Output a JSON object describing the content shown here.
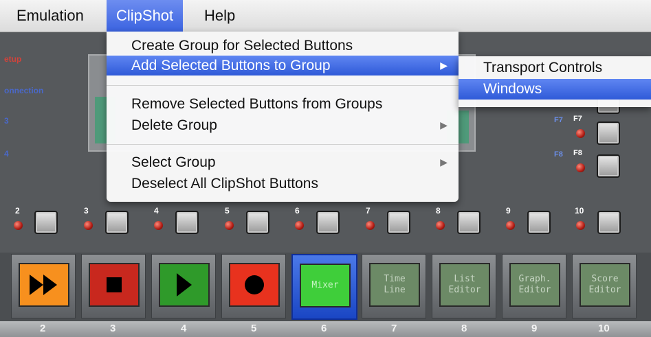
{
  "menubar": {
    "items": [
      {
        "label": "Emulation"
      },
      {
        "label": "ClipShot"
      },
      {
        "label": "Help"
      }
    ]
  },
  "clipshot_menu": {
    "items": [
      {
        "label": "Create Group for Selected Buttons"
      },
      {
        "label": "Add Selected Buttons to Group",
        "arrow": "▶"
      },
      {
        "label": "Remove Selected Buttons from Groups"
      },
      {
        "label": "Delete Group",
        "arrow": "▶"
      },
      {
        "label": "Select Group",
        "arrow": "▶"
      },
      {
        "label": "Deselect All ClipShot Buttons"
      }
    ]
  },
  "group_submenu": {
    "items": [
      {
        "label": "Transport Controls"
      },
      {
        "label": "Windows"
      }
    ]
  },
  "side_labels": [
    "etup",
    "onnection",
    "3",
    "4"
  ],
  "fkeys": {
    "f7_blue": "F7",
    "f7_white": "F7",
    "f8_blue": "F8",
    "f8_white": "F8"
  },
  "small_button_numbers": [
    "2",
    "3",
    "4",
    "5",
    "6",
    "7",
    "8",
    "9",
    "10"
  ],
  "big_buttons": [
    {
      "label": "",
      "icon": "fast-forward-icon",
      "color": "#f7901e"
    },
    {
      "label": "",
      "icon": "stop-icon",
      "color": "#c8281e"
    },
    {
      "label": "",
      "icon": "play-icon",
      "color": "#2f9a2a"
    },
    {
      "label": "",
      "icon": "record-icon",
      "color": "#e8321e"
    },
    {
      "label": "Mixer",
      "color": "#3fce3a",
      "selected": true
    },
    {
      "label": "Time\nLine",
      "color": "#6c8a66"
    },
    {
      "label": "List\nEditor",
      "color": "#6c8a66"
    },
    {
      "label": "Graph.\nEditor",
      "color": "#6c8a66"
    },
    {
      "label": "Score\nEditor",
      "color": "#6c8a66"
    }
  ],
  "bottom_numbers": [
    "2",
    "3",
    "4",
    "5",
    "6",
    "7",
    "8",
    "9",
    "10"
  ]
}
